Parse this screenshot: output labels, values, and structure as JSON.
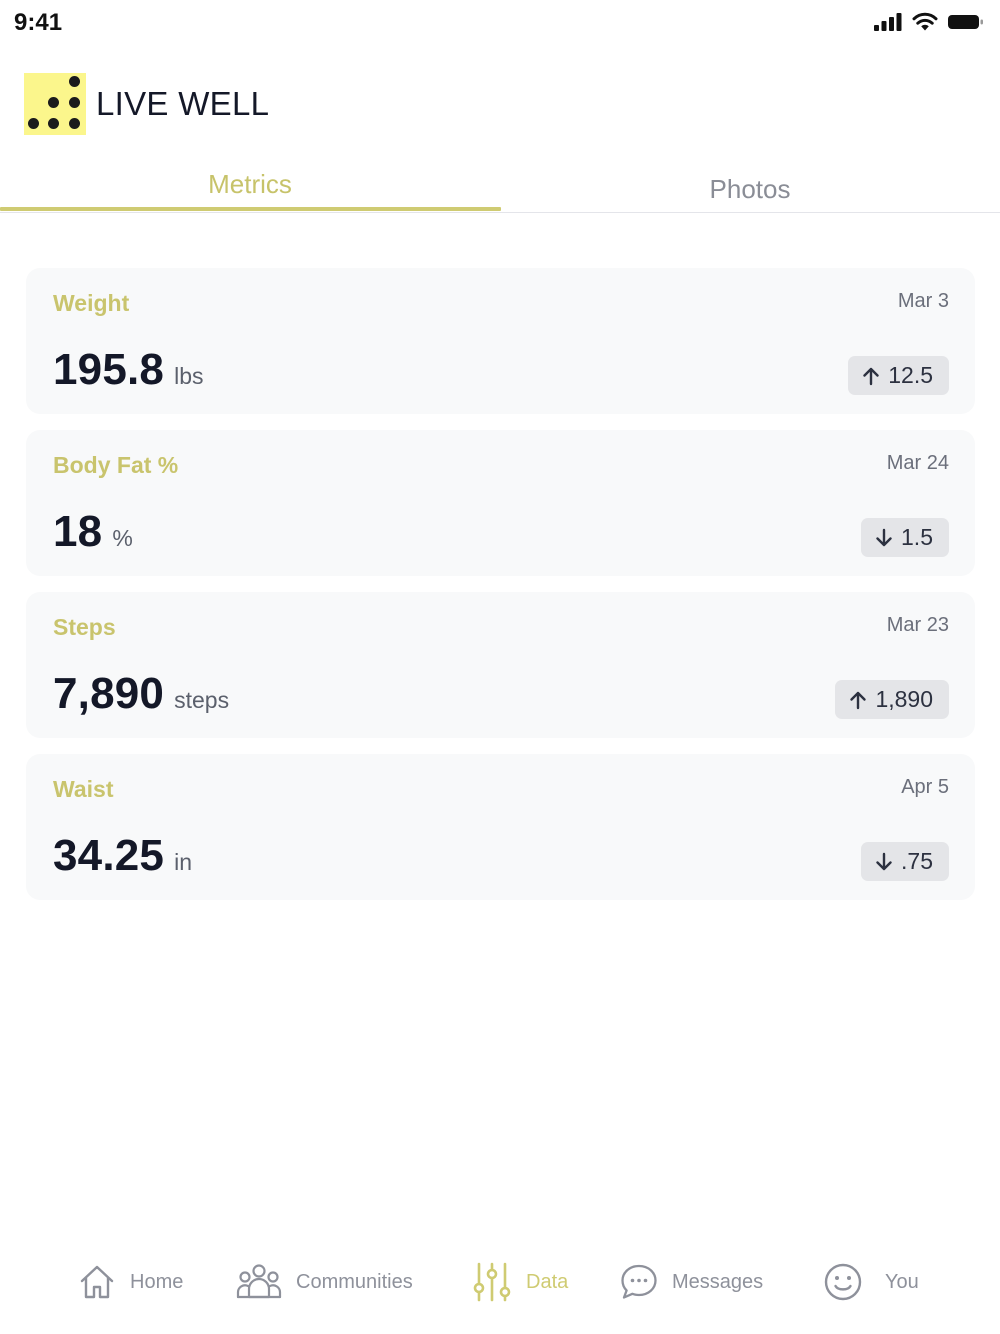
{
  "status_bar": {
    "time": "9:41"
  },
  "brand": {
    "name": "LIVE WELL"
  },
  "tabs": [
    {
      "label": "Metrics",
      "active": true
    },
    {
      "label": "Photos",
      "active": false
    }
  ],
  "metrics": [
    {
      "title": "Weight",
      "date": "Mar 3",
      "value": "195.8",
      "unit": "lbs",
      "delta": "12.5",
      "direction": "up"
    },
    {
      "title": "Body Fat %",
      "date": "Mar 24",
      "value": "18",
      "unit": "%",
      "delta": "1.5",
      "direction": "down"
    },
    {
      "title": "Steps",
      "date": "Mar 23",
      "value": "7,890",
      "unit": "steps",
      "delta": "1,890",
      "direction": "up"
    },
    {
      "title": "Waist",
      "date": "Apr 5",
      "value": "34.25",
      "unit": "in",
      "delta": ".75",
      "direction": "down"
    }
  ],
  "nav": [
    {
      "label": "Home",
      "icon": "home-icon",
      "active": false
    },
    {
      "label": "Communities",
      "icon": "people-icon",
      "active": false
    },
    {
      "label": "Data",
      "icon": "sliders-icon",
      "active": true
    },
    {
      "label": "Messages",
      "icon": "chat-icon",
      "active": false
    },
    {
      "label": "You",
      "icon": "smiley-icon",
      "active": false
    }
  ],
  "colors": {
    "accent": "#cfcb72",
    "logo_bg": "#fbf68c",
    "card_bg": "#f8f9fa",
    "delta_bg": "#e4e5e8",
    "text_dark": "#141828",
    "text_muted": "#8e919b"
  }
}
